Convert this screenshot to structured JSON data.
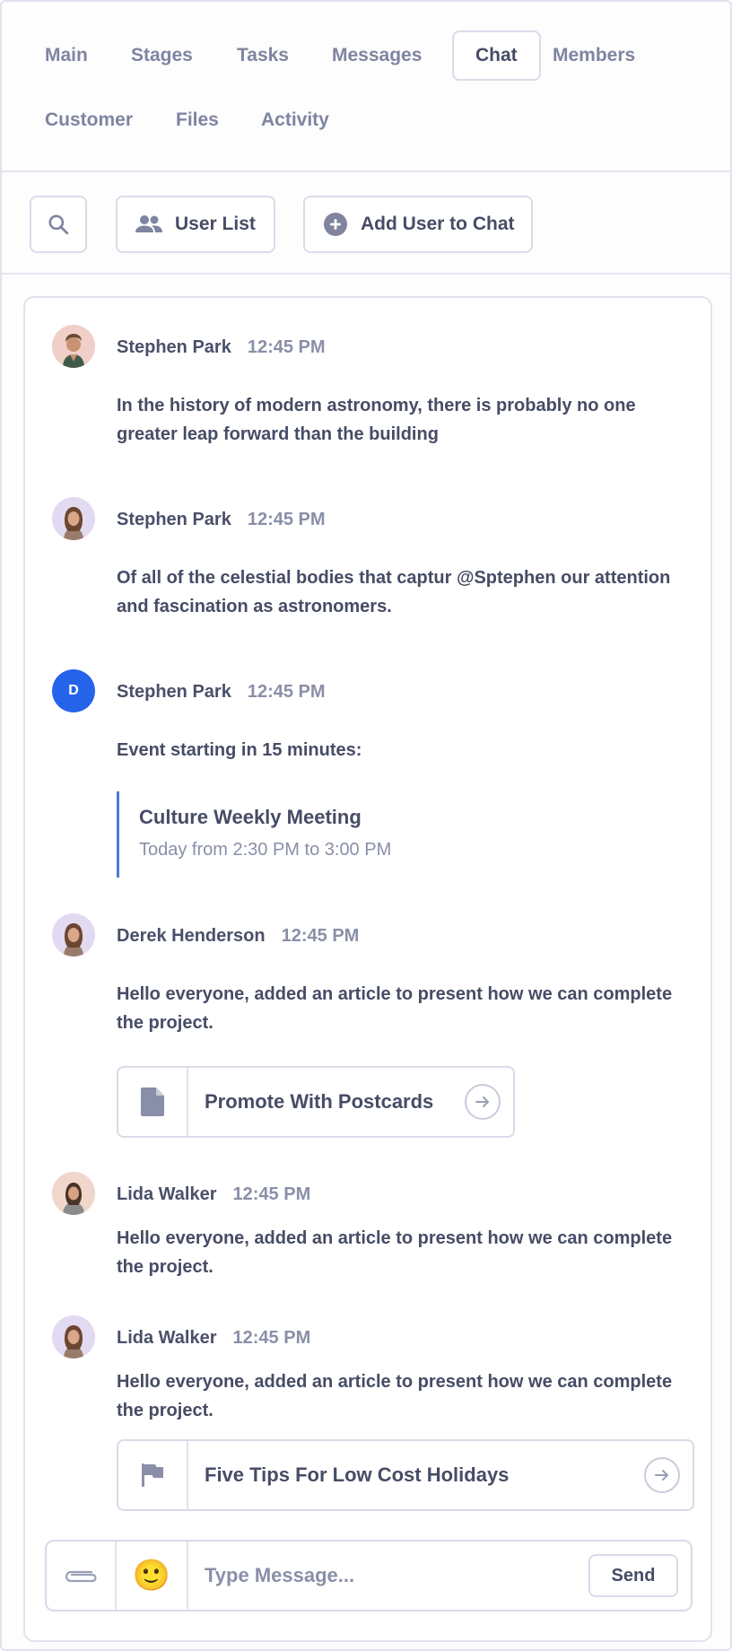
{
  "tabs": [
    {
      "label": "Main"
    },
    {
      "label": "Stages"
    },
    {
      "label": "Tasks"
    },
    {
      "label": "Messages"
    },
    {
      "label": "Chat",
      "active": true
    },
    {
      "label": "Members"
    },
    {
      "label": "Customer"
    },
    {
      "label": "Files"
    },
    {
      "label": "Activity"
    }
  ],
  "toolbar": {
    "search_icon": "search-icon",
    "user_list_label": "User List",
    "add_user_label": "Add User to Chat"
  },
  "messages": [
    {
      "name": "Stephen Park",
      "time": "12:45 PM",
      "text": "In the history of modern astronomy, there is probably no one greater leap forward than the building",
      "avatar": "photo-man"
    },
    {
      "name": "Stephen Park",
      "time": "12:45 PM",
      "text": "Of all of the celestial bodies that captur @Sptephen our attention and fascination as astronomers.",
      "avatar": "photo-woman"
    },
    {
      "name": "Stephen Park",
      "time": "12:45 PM",
      "text": "Event starting in 15 minutes:",
      "avatar_initial": "D",
      "event": {
        "title": "Culture Weekly Meeting",
        "time": "Today from 2:30 PM to 3:00 PM"
      }
    },
    {
      "name": "Derek Henderson",
      "time": "12:45 PM",
      "text": "Hello everyone, added an article to present how we can complete the project.",
      "avatar": "photo-woman",
      "attachment": {
        "title": "Promote With Postcards",
        "icon": "document-icon"
      }
    },
    {
      "name": "Lida Walker",
      "time": "12:45 PM",
      "text": "Hello everyone, added an article to present how we can complete the project.",
      "avatar": "photo-woman-2"
    },
    {
      "name": "Lida Walker",
      "time": "12:45 PM",
      "text": "Hello everyone, added an article to present how we can complete the project.",
      "avatar": "photo-woman",
      "attachment": {
        "title": "Five Tips For Low Cost Holidays",
        "icon": "flag-icon"
      }
    }
  ],
  "composer": {
    "placeholder": "Type Message...",
    "send_label": "Send",
    "emoji": "🙂"
  },
  "colors": {
    "accent_blue": "#2563eb",
    "event_border": "#4b7bd3"
  }
}
